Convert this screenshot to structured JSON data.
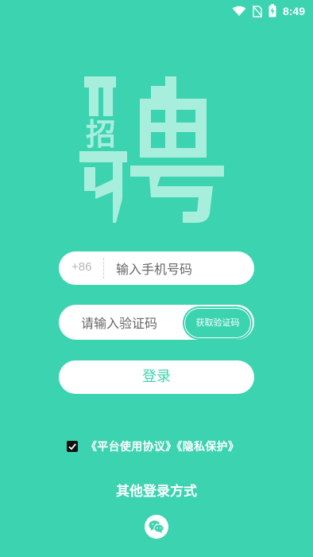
{
  "status_bar": {
    "time": "8:49",
    "icons": [
      "wifi-icon",
      "no-sim-icon",
      "battery-charging-icon"
    ]
  },
  "logo": {
    "main_char": "聘",
    "sub_char": "招"
  },
  "phone": {
    "country_code": "+86",
    "placeholder": "输入手机号码",
    "value": ""
  },
  "code": {
    "placeholder": "请输入验证码",
    "value": "",
    "get_code_label": "获取验证码"
  },
  "login": {
    "label": "登录"
  },
  "agreement": {
    "checked": true,
    "text": "《平台使用协议》《隐私保护》"
  },
  "other_login": {
    "title": "其他登录方式",
    "icons": [
      "wechat-icon"
    ]
  },
  "colors": {
    "background": "#3cd3b0",
    "accent": "#3cd3b0",
    "logo": "#a8eedd"
  }
}
